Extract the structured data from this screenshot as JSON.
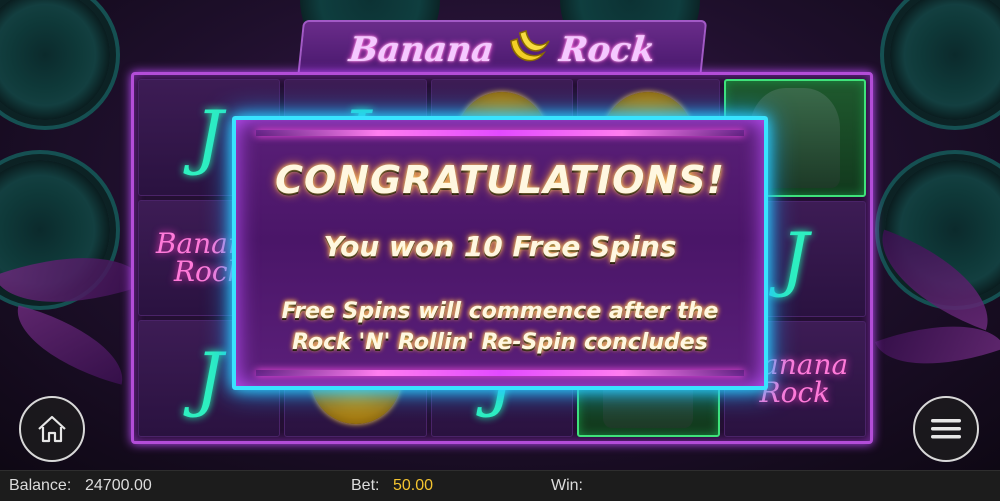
{
  "game": {
    "title_left": "Banana",
    "title_right": "Rock"
  },
  "popup": {
    "heading": "CONGRATULATIONS!",
    "award": "You won 10 Free Spins",
    "message_line1": "Free Spins will commence after the",
    "message_line2": "Rock 'N' Rollin' Re-Spin concludes"
  },
  "reel_symbols": {
    "banana_rock_line1": "Banana",
    "banana_rock_line2": "Rock"
  },
  "buttons": {
    "home": "home-icon",
    "menu": "menu-icon"
  },
  "status": {
    "balance_label": "Balance:",
    "balance_value": "24700.00",
    "bet_label": "Bet:",
    "bet_value": "50.00",
    "win_label": "Win:",
    "win_value": ""
  },
  "colors": {
    "popup_border": "#39e3ff",
    "frame": "#b34dd8",
    "bet_value": "#f4c430",
    "highlight": "#3fe37a"
  }
}
